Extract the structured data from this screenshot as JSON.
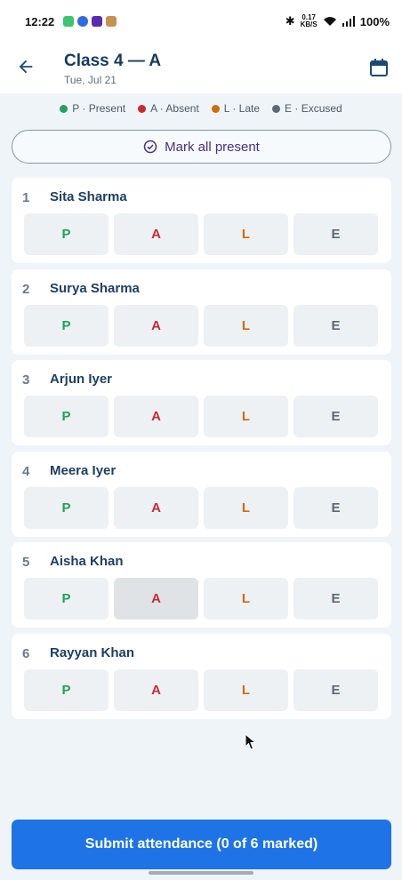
{
  "status_bar": {
    "time": "12:22",
    "net_speed_top": "0.17",
    "net_speed_bottom": "KB/S",
    "battery": "100%"
  },
  "header": {
    "title": "Class 4 — A",
    "date": "Tue, Jul 21"
  },
  "legend": [
    {
      "label": "P · Present",
      "color": "#22a15a"
    },
    {
      "label": "A · Absent",
      "color": "#c62b34"
    },
    {
      "label": "L · Late",
      "color": "#d36b07"
    },
    {
      "label": "E · Excused",
      "color": "#5c6873"
    }
  ],
  "mark_all_label": "Mark all present",
  "option_labels": {
    "p": "P",
    "a": "A",
    "l": "L",
    "e": "E"
  },
  "students": [
    {
      "num": "1",
      "name": "Sita Sharma"
    },
    {
      "num": "2",
      "name": "Surya Sharma"
    },
    {
      "num": "3",
      "name": "Arjun Iyer"
    },
    {
      "num": "4",
      "name": "Meera Iyer"
    },
    {
      "num": "5",
      "name": "Aisha Khan"
    },
    {
      "num": "6",
      "name": "Rayyan Khan"
    }
  ],
  "submit_label": "Submit attendance (0 of 6 marked)"
}
